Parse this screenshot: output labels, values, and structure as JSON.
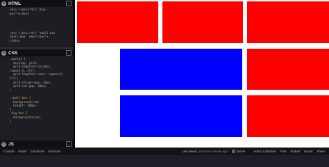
{
  "html_panel": {
    "title": "HTML",
    "lines": [
      "<div class=\"div\" big-",
      "box\"></div>",
      "",
      "",
      "",
      "",
      "<div class=\"div\" small-box",
      "small-box  small-box\">",
      "</div>"
    ]
  },
  "css_panel": {
    "title": "CSS",
    "lines": [
      ".parent {",
      "  display: grid;",
      "  grid-template-columns:",
      "repeat(3, 1fr);",
      "  grid-template-rows: repeat(3,",
      "1fr);",
      "  grid-column-gap: 20px;",
      "  grid-row-gap: 20px;",
      "}",
      "",
      ".small-box {",
      "  background:red;",
      "  height: 100px;",
      "}",
      ".big-box {",
      "  background:blue;",
      "}"
    ]
  },
  "js_panel": {
    "title": "JS"
  },
  "statusbar": {
    "left_buttons": [
      "Console",
      "Assets",
      "Comments",
      "Shortcuts"
    ],
    "last_saved_label": "Last saved:",
    "last_saved_value": "just now a minute ago",
    "right_buttons": [
      "Delete",
      "Add to Collection",
      "Fork",
      "Embed",
      "Export",
      "Share"
    ]
  },
  "preview": {
    "boxes": [
      {
        "color": "#ff0000",
        "kind": "small-box"
      },
      {
        "color": "#ff0000",
        "kind": "small-box"
      },
      {
        "color": "#ff0000",
        "kind": "small-box"
      },
      {
        "color": "#0000ff",
        "kind": "big-box"
      },
      {
        "color": "#ff0000",
        "kind": "small-box"
      },
      {
        "color": "#0000ff",
        "kind": "big-box"
      },
      {
        "color": "#ff0000",
        "kind": "small-box"
      }
    ]
  }
}
